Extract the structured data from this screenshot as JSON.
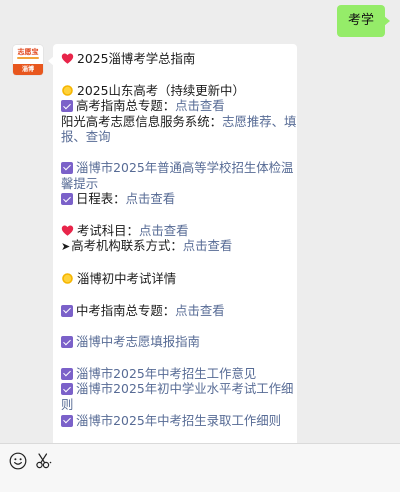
{
  "user_message": "考学",
  "avatar": {
    "top_text": "志愿宝",
    "bottom_text": "淄博"
  },
  "bot_message": {
    "title": "2025淄博考学总指南",
    "sd_title": "2025山东高考（持续更新中）",
    "gk_guide_label": "高考指南总专题：",
    "gk_guide_link": "点击查看",
    "sunshine_label": "阳光高考志愿信息服务系统：",
    "sunshine_link_1": "志愿推荐、填",
    "sunshine_link_2": "报、查询",
    "physical_link_1": "淄博市2025年普通高等学校招生体检温",
    "physical_link_2": "馨提示",
    "schedule_label": "日程表：",
    "schedule_link": "点击查看",
    "subjects_label": "考试科目：",
    "subjects_link": "点击查看",
    "contact_label": "高考机构联系方式：",
    "contact_link": "点击查看",
    "zk_title": "淄博初中考试详情",
    "zk_guide_label": "中考指南总专题：",
    "zk_guide_link": "点击查看",
    "zk_fill_link": "淄博中考志愿填报指南",
    "zk_work_link": "淄博市2025年中考招生工作意见",
    "zk_exam_link_1": "淄博市2025年初中学业水平考试工作细",
    "zk_exam_link_2": "则",
    "zk_admit_link": "淄博市2025年中考招生录取工作细则"
  },
  "icons": {
    "heart": "heart-icon",
    "sun": "sun-icon",
    "check": "check-box-icon",
    "arrow": "arrow-right-icon",
    "voice": "voice-icon",
    "scissors": "scissors-icon"
  },
  "colors": {
    "user_bubble": "#95ec69",
    "link": "#576b95",
    "check": "#7b61c9",
    "heart": "#e8254a",
    "sun": "#f5b500"
  }
}
